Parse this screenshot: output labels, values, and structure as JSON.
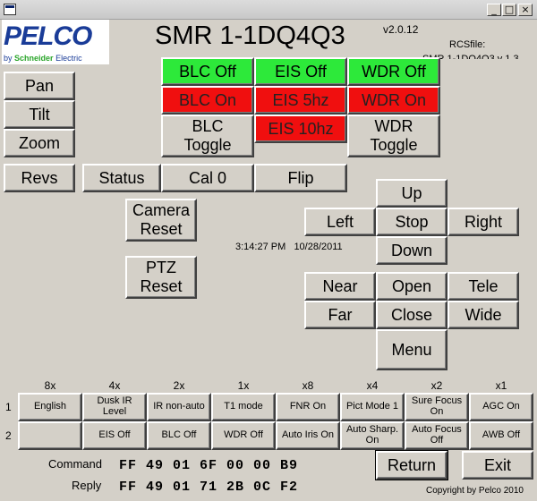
{
  "window": {
    "minimize": "_",
    "maximize": "□",
    "close": "×"
  },
  "header": {
    "logo": "PELCO",
    "logo_sub_prefix": "by",
    "logo_sub_brand": "Schneider",
    "logo_sub_suffix": "Electric",
    "title": "SMR 1-1DQ4Q3",
    "version": "v2.0.12",
    "rcs_label": "RCSfile:",
    "rcs_value": "SMR 1-1DQ4Q3 v 1.3"
  },
  "left_buttons": {
    "pan": "Pan",
    "tilt": "Tilt",
    "zoom": "Zoom",
    "revs": "Revs",
    "status": "Status",
    "cal0": "Cal 0",
    "flip": "Flip"
  },
  "blc": {
    "off": "BLC Off",
    "on": "BLC On",
    "toggle": "BLC\nToggle"
  },
  "eis": {
    "off": "EIS Off",
    "hz5": "EIS 5hz",
    "hz10": "EIS 10hz"
  },
  "wdr": {
    "off": "WDR Off",
    "on": "WDR On",
    "toggle": "WDR\nToggle"
  },
  "reset": {
    "camera": "Camera\nReset",
    "ptz": "PTZ\nReset"
  },
  "datetime": {
    "time": "3:14:27 PM",
    "date": "10/28/2011"
  },
  "ptz": {
    "up": "Up",
    "left": "Left",
    "stop": "Stop",
    "right": "Right",
    "down": "Down"
  },
  "lens": {
    "near": "Near",
    "open": "Open",
    "tele": "Tele",
    "far": "Far",
    "close": "Close",
    "wide": "Wide",
    "menu": "Menu"
  },
  "grid": {
    "col_headers": [
      "8x",
      "4x",
      "2x",
      "1x",
      "x8",
      "x4",
      "x2",
      "x1"
    ],
    "row_headers": [
      "1",
      "2"
    ],
    "row1": [
      "English",
      "Dusk IR Level",
      "IR non-auto",
      "T1 mode",
      "FNR On",
      "Pict Mode 1",
      "Sure Focus On",
      "AGC On"
    ],
    "row2": [
      "",
      "EIS Off",
      "BLC Off",
      "WDR Off",
      "Auto Iris On",
      "Auto Sharp. On",
      "Auto Focus Off",
      "AWB Off"
    ]
  },
  "command": {
    "label": "Command",
    "value": "FF 49 01 6F 00 00 B9"
  },
  "reply": {
    "label": "Reply",
    "value": "FF 49 01 71 2B 0C F2"
  },
  "actions": {
    "return": "Return",
    "exit": "Exit"
  },
  "footer": {
    "copyright": "Copyright by Pelco 2010"
  },
  "colors": {
    "green": "#2de93a",
    "red": "#f00f0f",
    "face": "#d4d0c8"
  }
}
